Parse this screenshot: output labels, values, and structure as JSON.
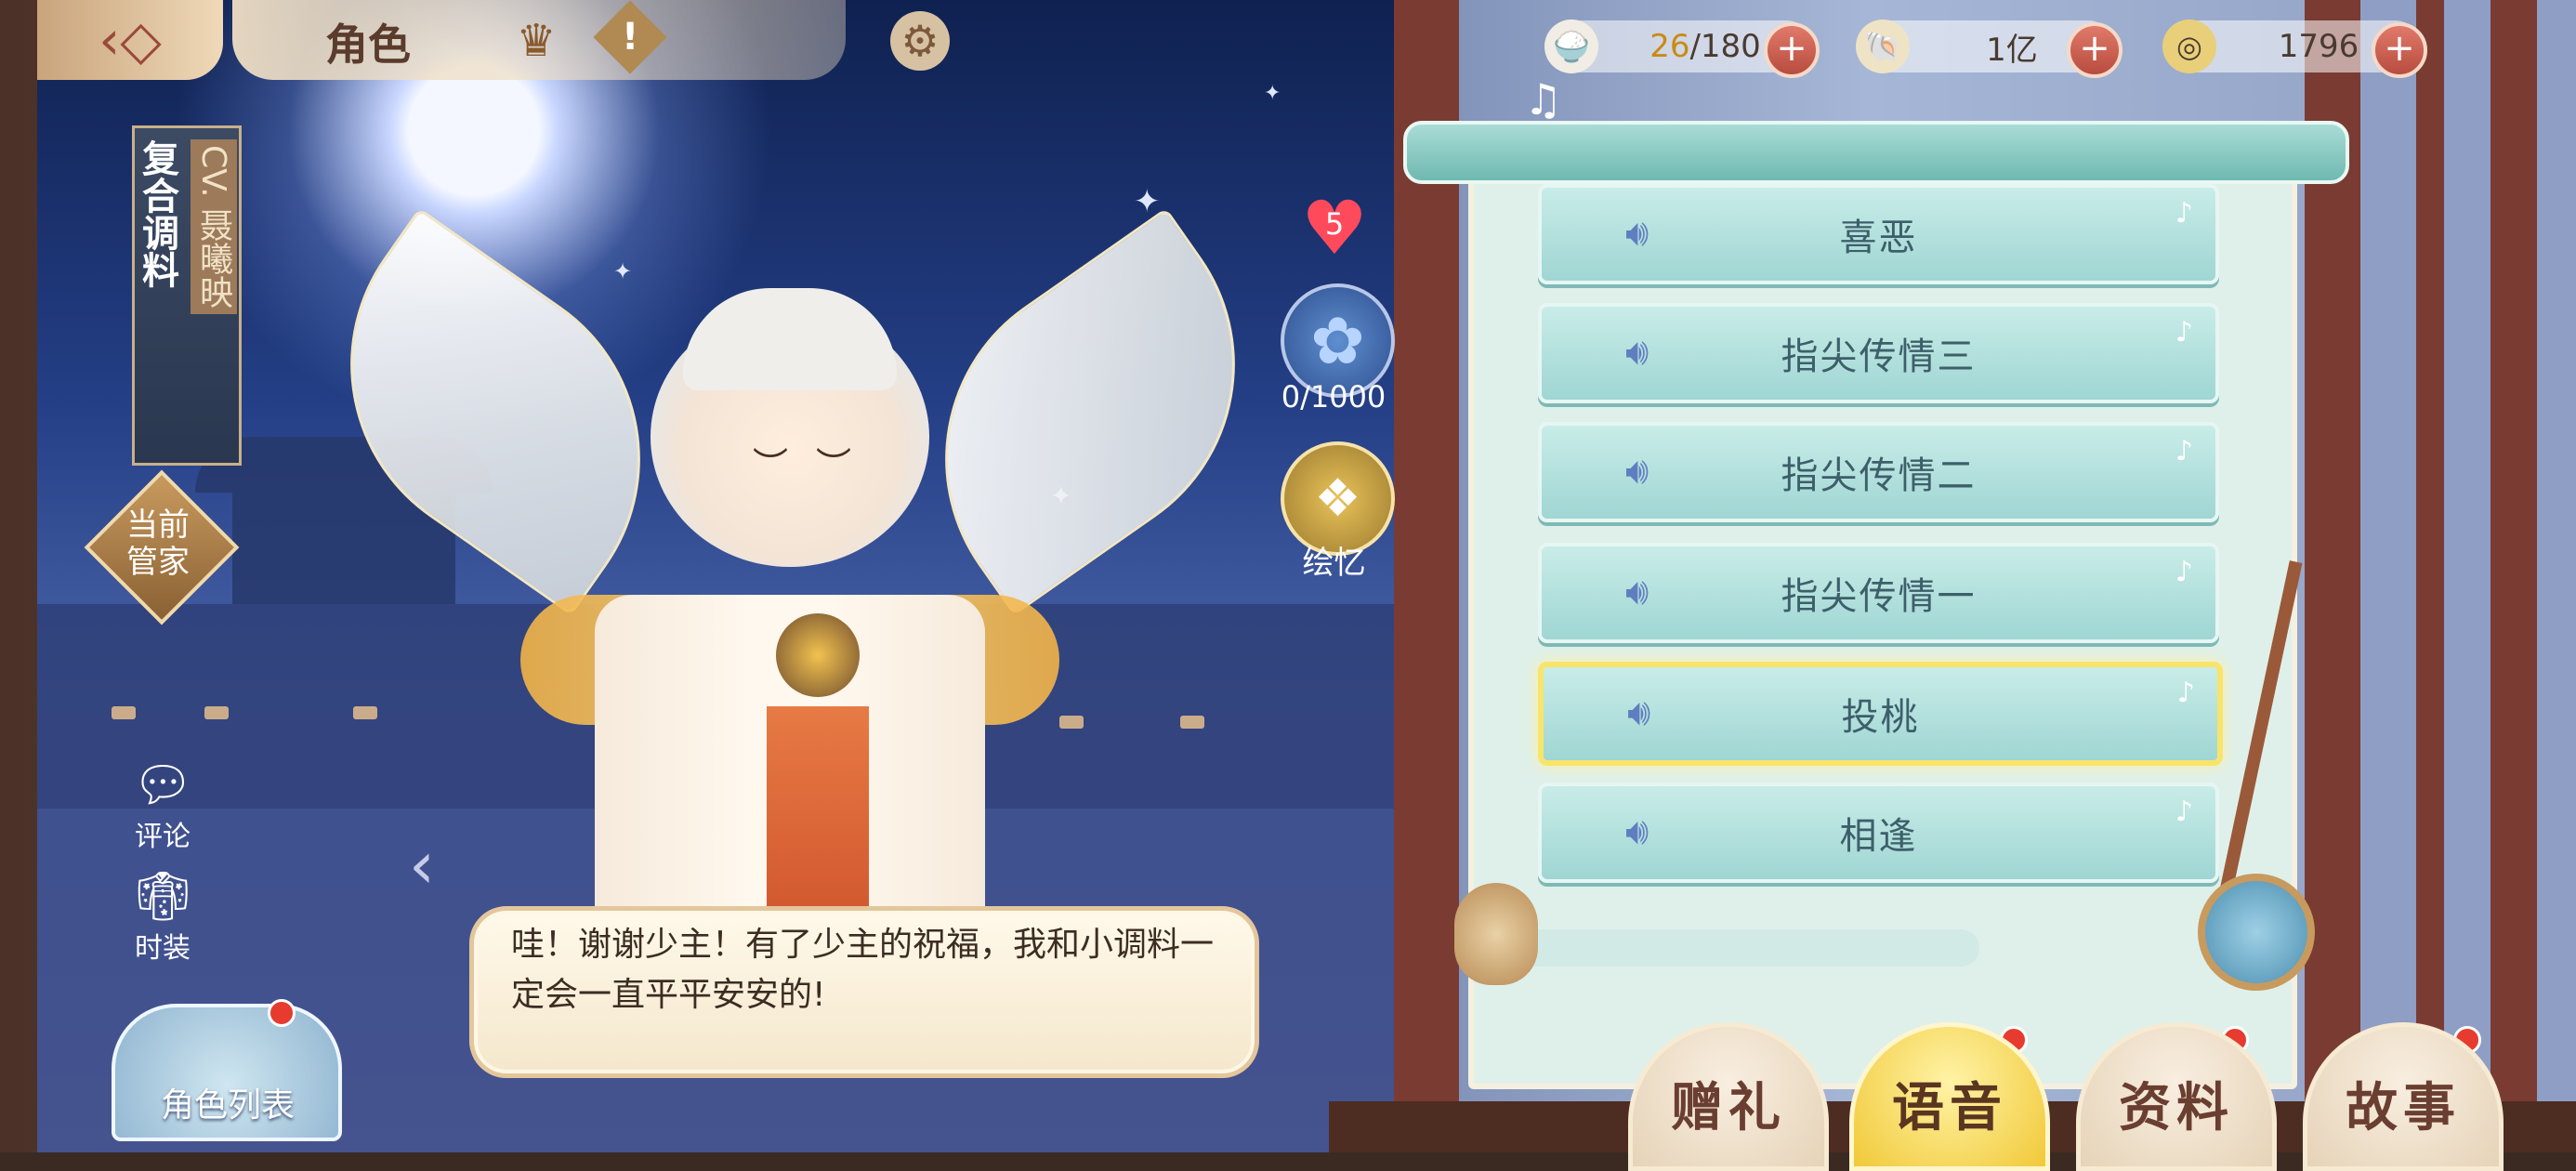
{
  "header": {
    "title": "角色",
    "back_icon": "back-arrow-icon",
    "crown_icon": "crown-icon",
    "alert_icon": "exclamation-icon",
    "settings_icon": "gear-icon"
  },
  "resources": [
    {
      "name": "rice-bowl-icon",
      "current": "26",
      "max": "/180"
    },
    {
      "name": "shell-icon",
      "value": "1亿"
    },
    {
      "name": "coin-icon",
      "value": "1796"
    }
  ],
  "character": {
    "name": "复合调料",
    "cv": "CV. 聂曦映",
    "butler_label": "当前管家",
    "affection_level": "5",
    "affection_progress": "0/1000",
    "memory_label": "绘忆"
  },
  "side_buttons": {
    "comment": "评论",
    "costume": "时装",
    "role_list": "角色列表"
  },
  "dialog": {
    "text": "哇！谢谢少主！有了少主的祝福，我和小调料一定会一直平平安安的!"
  },
  "voice_list": [
    {
      "label": "喜恶",
      "selected": false
    },
    {
      "label": "指尖传情三",
      "selected": false
    },
    {
      "label": "指尖传情二",
      "selected": false
    },
    {
      "label": "指尖传情一",
      "selected": false
    },
    {
      "label": "投桃",
      "selected": true
    },
    {
      "label": "相逢",
      "selected": false
    }
  ],
  "bottom_tabs": [
    {
      "label": "赠礼",
      "active": false,
      "badge": true
    },
    {
      "label": "语音",
      "active": true,
      "badge": true
    },
    {
      "label": "资料",
      "active": false,
      "badge": true
    },
    {
      "label": "故事",
      "active": false,
      "badge": true
    }
  ],
  "colors": {
    "accent_gold": "#f1c938",
    "badge_red": "#e63b2e",
    "voice_item": "#9fd6d3"
  }
}
